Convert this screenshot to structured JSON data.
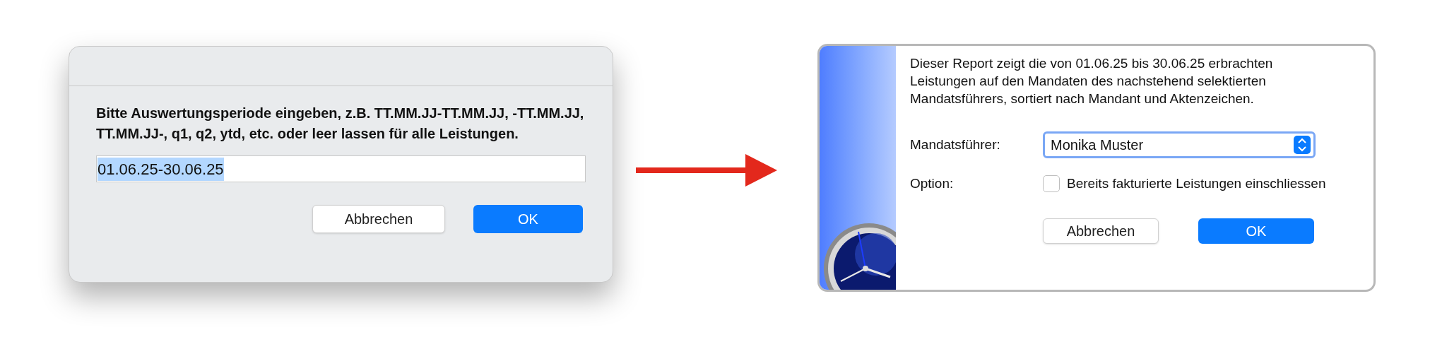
{
  "input_dialog": {
    "message": "Bitte Auswertungsperiode eingeben, z.B. TT.MM.JJ-TT.MM.JJ, -TT.MM.JJ, TT.MM.JJ-, q1, q2, ytd, etc. oder leer lassen für alle Leistungen.",
    "input": {
      "value": "01.06.25-30.06.25",
      "text_selected": true
    },
    "buttons": [
      {
        "label": "Abbrechen",
        "default": false
      },
      {
        "label": "OK",
        "default": true
      }
    ]
  },
  "report_dialog": {
    "description": "Dieser Report zeigt die von 01.06.25 bis 30.06.25 erbrachten Leistungen auf den Mandaten des nachstehend selektierten Mandatsführers, sortiert nach Mandant und Aktenzeichen.",
    "select": {
      "label": "Mandatsführer:",
      "value": "Monika Muster",
      "focused": true
    },
    "option": {
      "label": "Option:",
      "checkbox_label": "Bereits fakturierte Leistungen einschliessen",
      "checked": false
    },
    "buttons": [
      {
        "label": "Abbrechen",
        "default": false
      },
      {
        "label": "OK",
        "default": true
      }
    ]
  }
}
